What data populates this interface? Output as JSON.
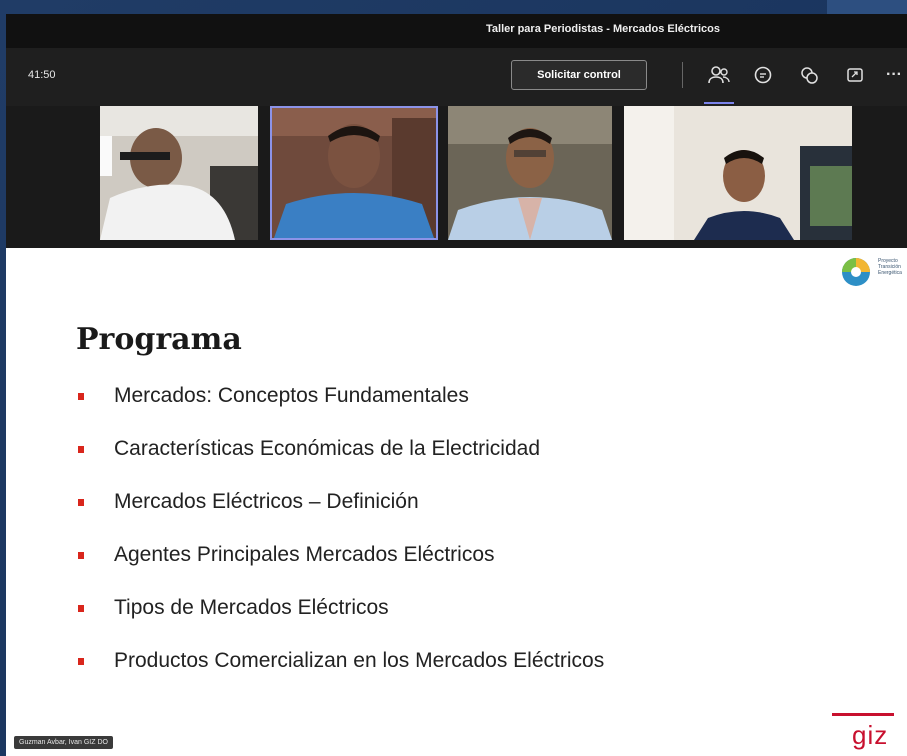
{
  "window": {
    "title": "Taller para Periodistas - Mercados Eléctricos"
  },
  "toolbar": {
    "timer": "41:50",
    "request_control_label": "Solicitar control",
    "icons": [
      "participants-icon",
      "chat-icon",
      "reactions-icon",
      "share-tray-icon",
      "more-options-icon"
    ],
    "more_label": "···"
  },
  "participants": [
    {
      "id": "participant-1",
      "shirt": "#f2f2f2"
    },
    {
      "id": "participant-2",
      "shirt": "#3a7fc4"
    },
    {
      "id": "participant-3",
      "shirt": "#b9cfe6"
    },
    {
      "id": "participant-4",
      "shirt": "#1d2c4f"
    }
  ],
  "slide": {
    "title": "Programa",
    "items": [
      "Mercados: Conceptos Fundamentales",
      "Características Económicas de la Electricidad",
      "Mercados Eléctricos – Definición",
      "Agentes Principales Mercados Eléctricos",
      "Tipos de Mercados Eléctricos",
      "Productos Comercializan en los Mercados Eléctricos"
    ],
    "logo_text": [
      "Proyecto",
      "Transición",
      "Energética"
    ],
    "footer_logo": "giz",
    "accent_color": "#d9261c"
  },
  "speaker_label": "Guzman Avbar, Ivan GIZ DO"
}
